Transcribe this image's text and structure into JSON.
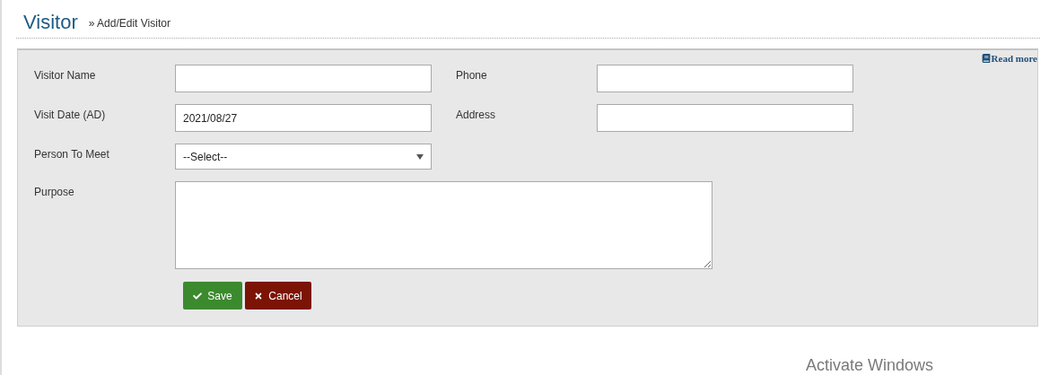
{
  "header": {
    "title": "Visitor",
    "breadcrumb_separator": "»",
    "breadcrumb": "Add/Edit Visitor"
  },
  "read_more": "Read more",
  "form": {
    "rows": [
      {
        "fields": [
          {
            "label": "Visitor Name",
            "kind": "text"
          },
          {
            "label": "Phone",
            "kind": "text"
          }
        ]
      },
      {
        "fields": [
          {
            "label": "Visit Date (AD)",
            "kind": "text",
            "value": "2021/08/27"
          },
          {
            "label": "Address",
            "kind": "text"
          }
        ]
      },
      {
        "fields": [
          {
            "label": "Person To Meet",
            "kind": "select",
            "value": "--Select--"
          }
        ]
      },
      {
        "fields": [
          {
            "label": "Purpose",
            "kind": "textarea"
          }
        ]
      }
    ]
  },
  "buttons": [
    {
      "label": "Save",
      "kind": "save"
    },
    {
      "label": "Cancel",
      "kind": "cancel"
    }
  ],
  "os_notice": "Activate Windows"
}
